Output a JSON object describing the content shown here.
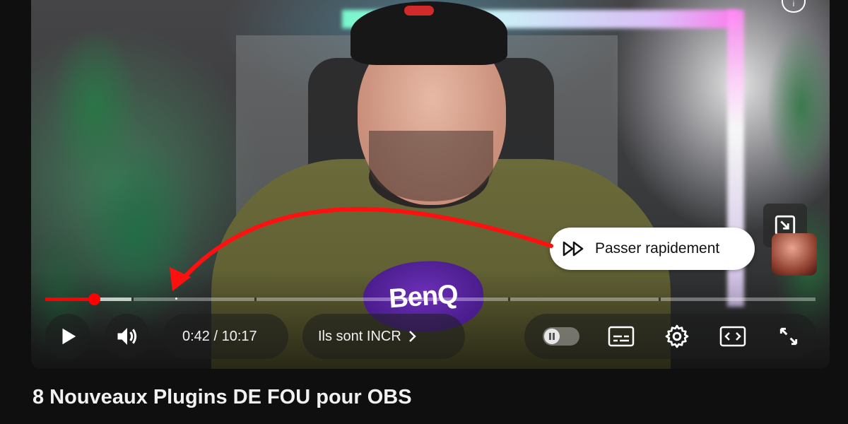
{
  "video": {
    "title": "8 Nouveaux Plugins DE FOU pour OBS",
    "logo_text": "BenQ"
  },
  "tooltip": {
    "label": "Passer rapidement",
    "icon": "fast-forward-icon"
  },
  "player_controls": {
    "play_icon": "play-icon",
    "volume_icon": "volume-icon",
    "time_display": "0:42 / 10:17",
    "chapter_label": "Ils sont INCR",
    "chapter_icon": "chevron-right-icon",
    "autoplay_icon": "autoplay-toggle-icon",
    "subtitles_icon": "subtitles-icon",
    "settings_icon": "gear-icon",
    "theater_icon": "theater-mode-icon",
    "fullscreen_icon": "fullscreen-icon",
    "pip_icon": "miniplayer-icon"
  },
  "colors": {
    "progress": "#ff0000",
    "annotation_arrow": "#ff1010",
    "tooltip_bg": "#ffffff"
  }
}
